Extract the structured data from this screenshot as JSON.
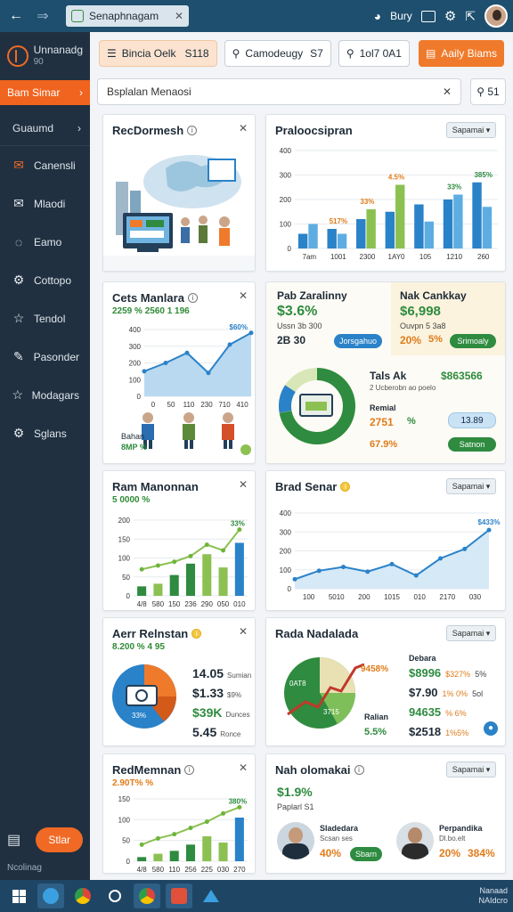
{
  "window": {
    "tab_title": "Senaphnagam",
    "user_label": "Bury"
  },
  "sidebar": {
    "app_name": "Unnanadg",
    "app_sub": "90",
    "primary_label": "Bam Simar",
    "section_label": "Guaumd",
    "items": [
      {
        "label": "Canensli",
        "icon": "mail-open-icon"
      },
      {
        "label": "Mlaodi",
        "icon": "envelope-icon"
      },
      {
        "label": "Eamo",
        "icon": "chat-icon"
      },
      {
        "label": "Cottopo",
        "icon": "gear-icon"
      },
      {
        "label": "Tendol",
        "icon": "star-icon"
      },
      {
        "label": "Pasonder",
        "icon": "pencil-icon"
      },
      {
        "label": "Modagars",
        "icon": "star-icon"
      },
      {
        "label": "Sglans",
        "icon": "gear-icon"
      }
    ],
    "start_label": "Stlar",
    "footer": "Ncolinag"
  },
  "toolbar": {
    "btn1_label": "Bincia Oelk",
    "btn1_value": "S118",
    "btn2_label": "Camodeugy",
    "btn2_value": "S7",
    "btn3_label": "1ol7 0A1",
    "btn4_label": "Aaily Biams"
  },
  "search": {
    "placeholder": "Bsplalan Menaosi",
    "btn_label": "51"
  },
  "cards": {
    "c1": {
      "title": "RecDormesh"
    },
    "c2": {
      "title": "Praloocsipran",
      "select": "Sapamai",
      "chart_data": {
        "type": "bar",
        "categories": [
          "7am",
          "1001",
          "2300",
          "1AY0",
          "105",
          "1210",
          "260"
        ],
        "ylim": [
          0,
          400
        ],
        "yticks": [
          "0",
          "100",
          "200",
          "300",
          "400"
        ],
        "series": [
          {
            "values": [
              60,
              80,
              120,
              150,
              180,
              200,
              270
            ]
          },
          {
            "values": [
              100,
              60,
              160,
              260,
              110,
              220,
              170
            ]
          }
        ],
        "labels": [
          "517%",
          "33%",
          "4.5%",
          "33%",
          "385%"
        ]
      }
    },
    "c3": {
      "title": "Cets Manlara",
      "subtitle": "2259 % 2560 1 196",
      "chart_data": {
        "type": "area",
        "x": [
          "0",
          "50",
          "110",
          "230",
          "710",
          "410"
        ],
        "y": [
          150,
          200,
          260,
          140,
          310,
          380
        ],
        "ylim": [
          0,
          400
        ],
        "yticks": [
          "0",
          "100",
          "200",
          "300",
          "400"
        ],
        "label": "$60%"
      },
      "people_label": "Bahan",
      "people_value": "8MP %"
    },
    "c4": {
      "title_left": "Pab Zaralinny",
      "value_left": "$3.6%",
      "sub_left": "Ussn 3b 300",
      "value_left2": "2B 30",
      "pill_left": "Jorsgahuo",
      "title_right": "Nak Cankkay",
      "value_right": "$6,998",
      "sub_right": "Ouvpn 5 3a8",
      "pct_right": "20%",
      "pct_right2": "5%",
      "pill_right": "Srimoaly",
      "inner_title": "Tals Ak",
      "inner_value": "$863566",
      "inner_sub": "2 Ucberobn ao poelo",
      "inner_label": "Remial",
      "inner_num": "2751",
      "inner_num2": "%",
      "inner_pct": "67.9%",
      "inner_pill1": "13.89",
      "inner_pill2": "Satnon",
      "donut_pct": 72
    },
    "c5": {
      "title": "Ram Manonnan",
      "subtitle": "5 0000 %",
      "chart_data": {
        "type": "bar",
        "categories": [
          "4/8",
          "580",
          "150",
          "236",
          "290",
          "050",
          "010"
        ],
        "values": [
          25,
          32,
          55,
          85,
          110,
          75,
          140
        ],
        "line": [
          70,
          80,
          90,
          105,
          135,
          120,
          175
        ],
        "ylim": [
          0,
          200
        ],
        "yticks": [
          "0",
          "50",
          "100",
          "150",
          "200"
        ],
        "label": "33%"
      }
    },
    "c6": {
      "title": "Brad Senar",
      "select": "Sapamai",
      "chart_data": {
        "type": "area",
        "x": [
          "100",
          "5010",
          "200",
          "1015",
          "010",
          "2170",
          "030"
        ],
        "y": [
          50,
          95,
          115,
          90,
          130,
          70,
          160,
          210,
          310
        ],
        "ylim": [
          0,
          400
        ],
        "yticks": [
          "0",
          "100",
          "200",
          "300",
          "400"
        ],
        "label": "$433%"
      }
    },
    "c7": {
      "title": "Aerr Relnstan",
      "subtitle": "8.200 % 4 95",
      "rows": [
        {
          "v": "14.05",
          "l": "Sumian"
        },
        {
          "v": "$1.33",
          "l": "$9%"
        },
        {
          "v": "$39K",
          "l": "Dunces"
        },
        {
          "v": "5.45",
          "l": "Ronce"
        }
      ],
      "pie_label": "33%"
    },
    "c8": {
      "title": "Rada Nadalada",
      "select": "Sapamai",
      "pie_left": "0AT8",
      "pie_right": "3715",
      "pct_top": "9458%",
      "label_top": "Debara",
      "rows": [
        {
          "v": "$8996",
          "p": "$327%",
          "q": "5%"
        },
        {
          "v": "$7.90",
          "p": "1% 0%",
          "q": "5ol"
        },
        {
          "v": "94635",
          "p": "% 6%",
          "q": ""
        },
        {
          "v": "$2518",
          "p": "1%5%",
          "q": ""
        }
      ],
      "left_label": "Ralian",
      "left_pct": "5.5%"
    },
    "c9": {
      "title": "RedMemnan",
      "subtitle": "2.90T% %",
      "chart_data": {
        "type": "bar",
        "categories": [
          "4/8",
          "580",
          "110",
          "256",
          "225",
          "030",
          "270"
        ],
        "values": [
          10,
          18,
          25,
          40,
          60,
          45,
          105
        ],
        "line": [
          40,
          55,
          65,
          80,
          95,
          115,
          130
        ],
        "ylim": [
          0,
          150
        ],
        "yticks": [
          "0",
          "50",
          "100",
          "150"
        ],
        "label": "380%"
      }
    },
    "c10": {
      "title": "Nah olomakai",
      "select": "Sapamai",
      "value": "$1.9%",
      "sub": "Paplarl S1",
      "p1_name": "Sladedara",
      "p1_role": "Scsan ses",
      "p1_pct": "40%",
      "p1_pill": "Sbarn",
      "p2_name": "Perpandika",
      "p2_role": "Dl.bo.elt",
      "p2_pct": "20%",
      "p2_pct2": "384%"
    }
  },
  "taskbar": {
    "tray_line1": "Nanaad",
    "tray_line2": "NAIdcro"
  },
  "colors": {
    "orange": "#f06a25",
    "blue": "#2a82c8",
    "green": "#2e8b3f",
    "lightgreen": "#8cc152",
    "lightblue": "#5dade2"
  }
}
